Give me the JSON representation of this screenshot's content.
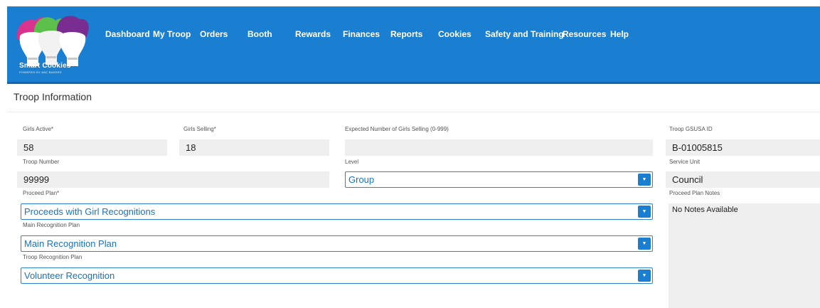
{
  "header": {
    "logo_text": "Smart Cookies",
    "logo_subtext": "POWERED BY ABC BAKERS",
    "nav": [
      "Dashboard",
      "My Troop",
      "Orders",
      "Booth",
      "Rewards",
      "Finances",
      "Reports",
      "Cookies",
      "Safety and Training",
      "Resources",
      "Help"
    ]
  },
  "page": {
    "title": "Troop Information"
  },
  "form": {
    "girls_active": {
      "label": "Girls Active*",
      "value": "58"
    },
    "girls_selling": {
      "label": "Girls Selling*",
      "value": "18"
    },
    "expected_girls": {
      "label": "Expected Number of Girls Selling (0-999)",
      "value": ""
    },
    "gsusa_id": {
      "label": "Troop GSUSA ID",
      "value": "B-01005815"
    },
    "troop_number": {
      "label": "Troop Number",
      "value": "99999"
    },
    "level": {
      "label": "Level",
      "value": "Group"
    },
    "service_unit": {
      "label": "Service Unit",
      "value": "Council"
    },
    "proceed_plan": {
      "label": "Proceed Plan*",
      "value": "Proceeds with Girl Recognitions"
    },
    "proceed_plan_notes": {
      "label": "Proceed Plan Notes",
      "value": "No Notes Available"
    },
    "main_recognition": {
      "label": "Main Recognition Plan",
      "value": "Main Recognition Plan"
    },
    "troop_recognition": {
      "label": "Troop Recognition Plan",
      "value": "Volunteer Recognition"
    }
  },
  "icons": {
    "dropdown": "chevron-down-icon"
  },
  "colors": {
    "header_bg": "#1a7fd1",
    "select_border": "#2b86cf",
    "select_text": "#1b72c2",
    "readonly_bg": "#efefef"
  }
}
